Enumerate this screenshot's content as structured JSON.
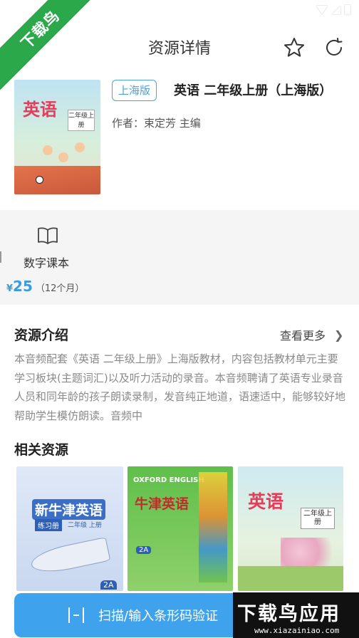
{
  "watermark_corner": "下载鸟",
  "nav": {
    "title": "资源详情"
  },
  "book": {
    "cover_title": "英语",
    "cover_tag": "二年级上册",
    "badge": "上海版",
    "title": "英语 二年级上册（上海版）",
    "author": "作者：束定芳 主编"
  },
  "product": {
    "label": "数字课本",
    "currency": "¥",
    "price": "25",
    "period": "（12个月）"
  },
  "intro": {
    "title": "资源介绍",
    "more": "查看更多",
    "text": "本音频配套《英语 二年级上册》上海版教材，内容包括教材单元主要学习板块(主题词汇)以及听力活动的录音。本音频聘请了英语专业录音人员和同年龄的孩子朗读录制，发音纯正地道，语速适中，能够较好地帮助学生模仿朗读。音频中"
  },
  "related": {
    "title": "相关资源",
    "items": [
      {
        "cover_title": "新牛津英语",
        "cover_sub": "练习册",
        "cover_grade": "二年级 上册",
        "cover_edition": "2A"
      },
      {
        "cover_top": "OXFORD ENGLISH",
        "cover_title": "牛津英语",
        "cover_edition": "2A"
      },
      {
        "cover_title": "英语",
        "cover_tag": "二年级上册"
      }
    ]
  },
  "scan": {
    "label": "扫描/输入条形码验证"
  },
  "watermark_bottom": {
    "main": "下载鸟应用",
    "sub": "www.xiazainiao.com"
  },
  "colors": {
    "accent": "#3ea3ec",
    "badge": "#4aa3df",
    "ribbon": "#2aa84a"
  }
}
